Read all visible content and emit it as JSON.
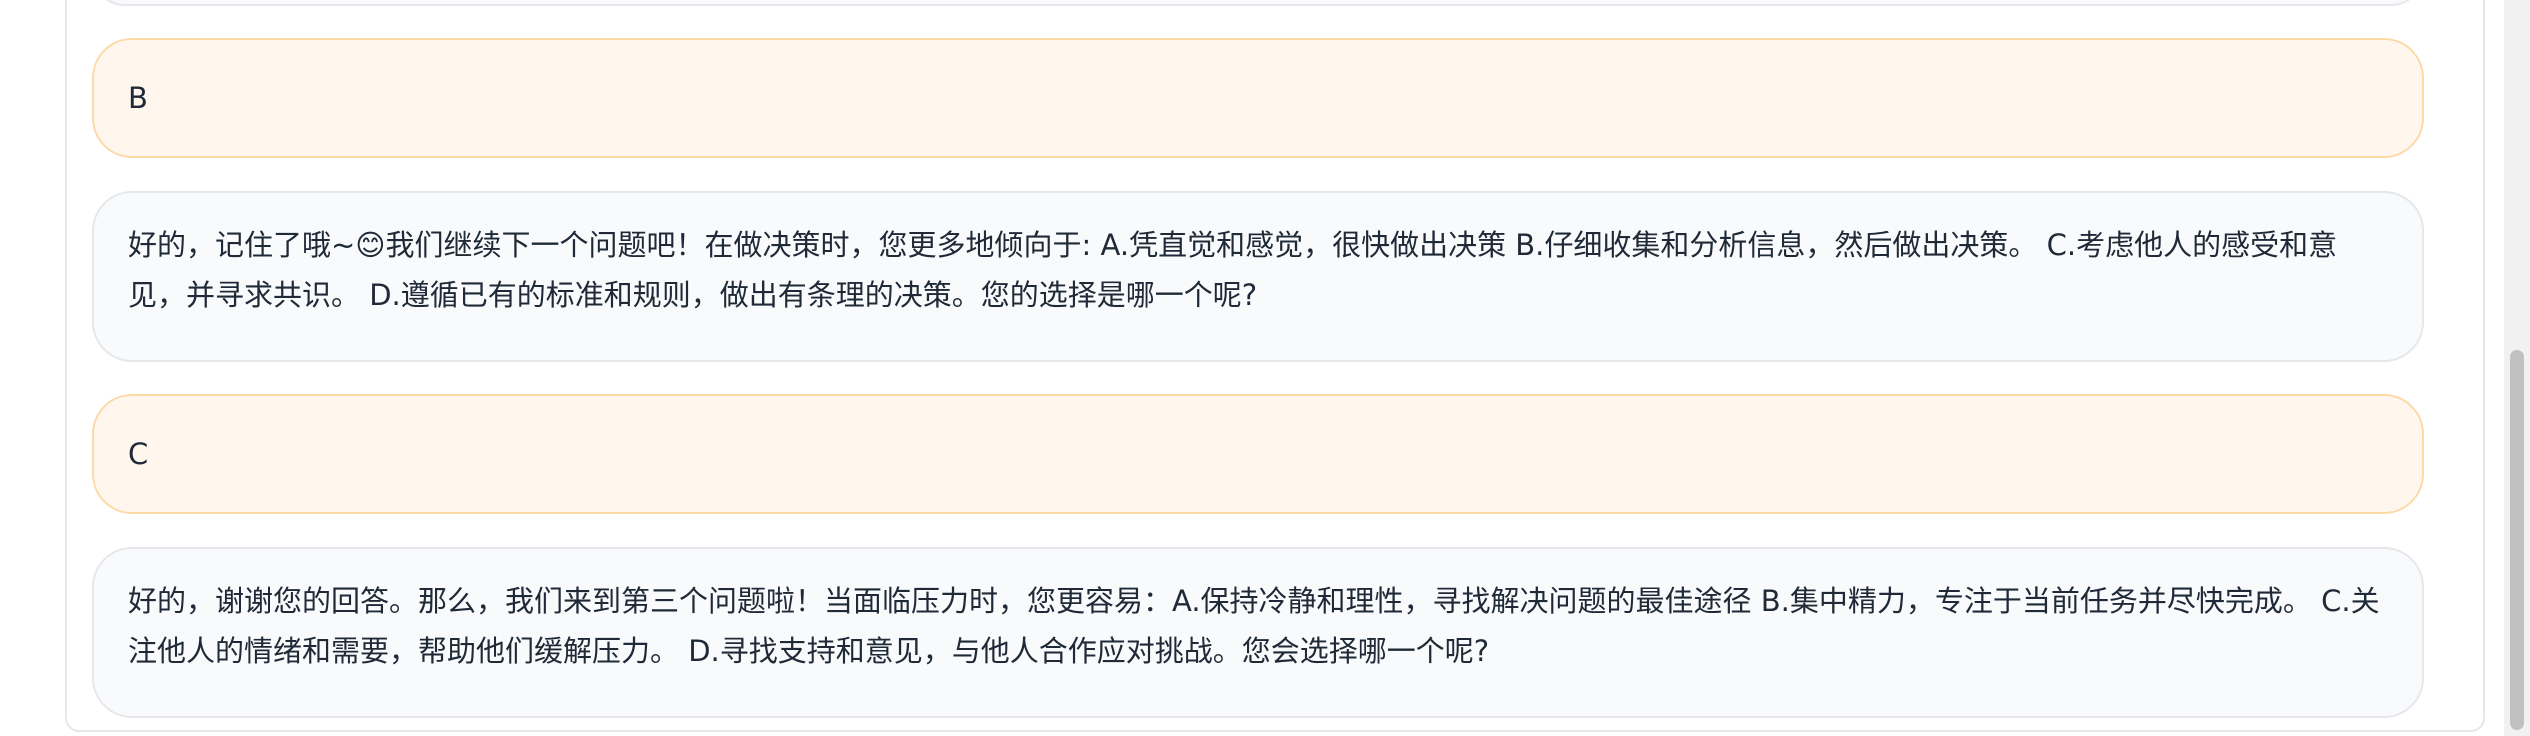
{
  "messages": [
    {
      "role": "user",
      "text": "B"
    },
    {
      "role": "assistant",
      "text": "好的，记住了哦~😊我们继续下一个问题吧！在做决策时，您更多地倾向于: A.凭直觉和感觉，很快做出决策 B.仔细收集和分析信息，然后做出决策。 C.考虑他人的感受和意见，并寻求共识。 D.遵循已有的标准和规则，做出有条理的决策。您的选择是哪一个呢?"
    },
    {
      "role": "user",
      "text": "C"
    },
    {
      "role": "assistant",
      "text": "好的，谢谢您的回答。那么，我们来到第三个问题啦！当面临压力时，您更容易：A.保持冷静和理性，寻找解决问题的最佳途径 B.集中精力，专注于当前任务并尽快完成。 C.关注他人的情绪和需要，帮助他们缓解压力。 D.寻找支持和意见，与他人合作应对挑战。您会选择哪一个呢?"
    }
  ],
  "colors": {
    "user_bubble_bg": "#fff7ed",
    "user_bubble_border": "#fdd9a8",
    "assistant_bubble_bg": "#f9fafb",
    "assistant_bubble_border": "#e5e7eb",
    "text": "#1f2937"
  }
}
